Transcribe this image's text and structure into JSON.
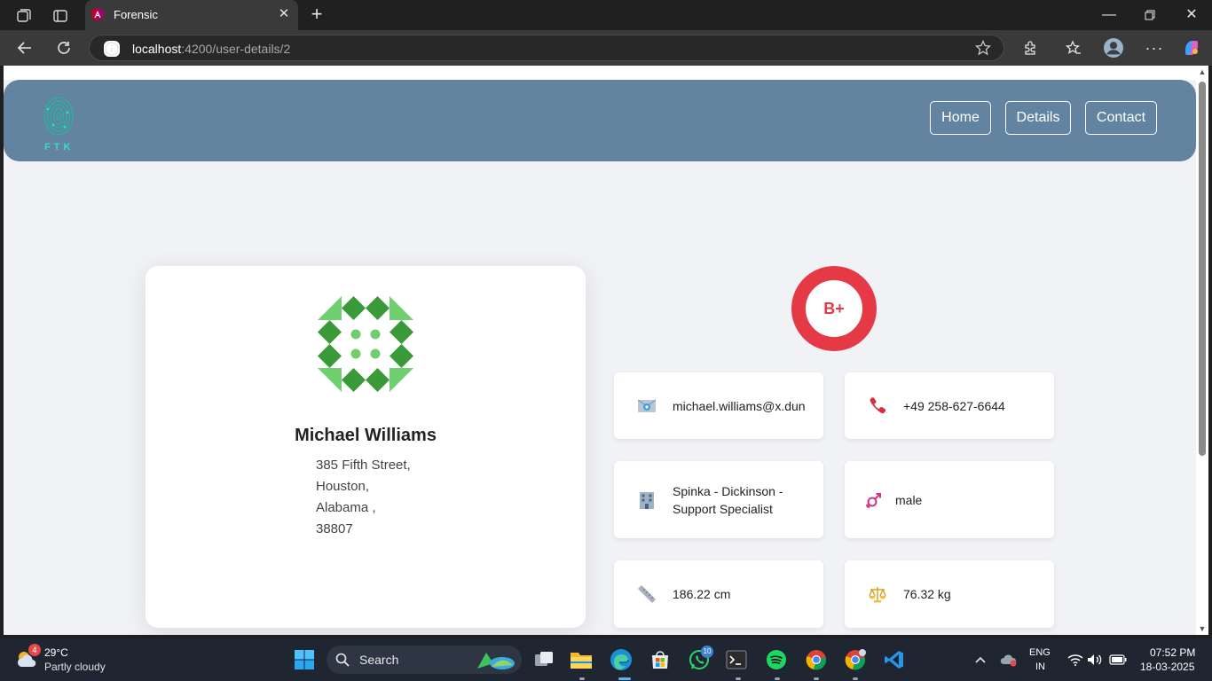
{
  "browser": {
    "tab_title": "Forensic",
    "url_host": "localhost",
    "url_path": ":4200/user-details/2"
  },
  "site": {
    "logo_text": "FTK",
    "nav": [
      {
        "label": "Home"
      },
      {
        "label": "Details"
      },
      {
        "label": "Contact"
      }
    ]
  },
  "profile": {
    "name": "Michael Williams",
    "address_lines": [
      "385 Fifth Street,",
      "Houston,",
      "Alabama ,",
      "38807"
    ],
    "blood_group": "B+",
    "email": "michael.williams@x.dun",
    "phone": "+49 258-627-6644",
    "company_line1": "Spinka - Dickinson -",
    "company_line2": "Support Specialist",
    "gender": "male",
    "height": "186.22 cm",
    "weight": "76.32 kg"
  },
  "taskbar": {
    "temperature": "29°C",
    "weather": "Partly cloudy",
    "weather_badge": "4",
    "search_placeholder": "Search",
    "whatsapp_badge": "10",
    "lang_line1": "ENG",
    "lang_line2": "IN",
    "time": "07:52 PM",
    "date": "18-03-2025"
  },
  "colors": {
    "header": "#6384a1",
    "accent_red": "#e63946",
    "avatar_green_dark": "#3a9a3a",
    "avatar_green_light": "#6fcf6f",
    "logo_teal": "#2fe0c0"
  }
}
